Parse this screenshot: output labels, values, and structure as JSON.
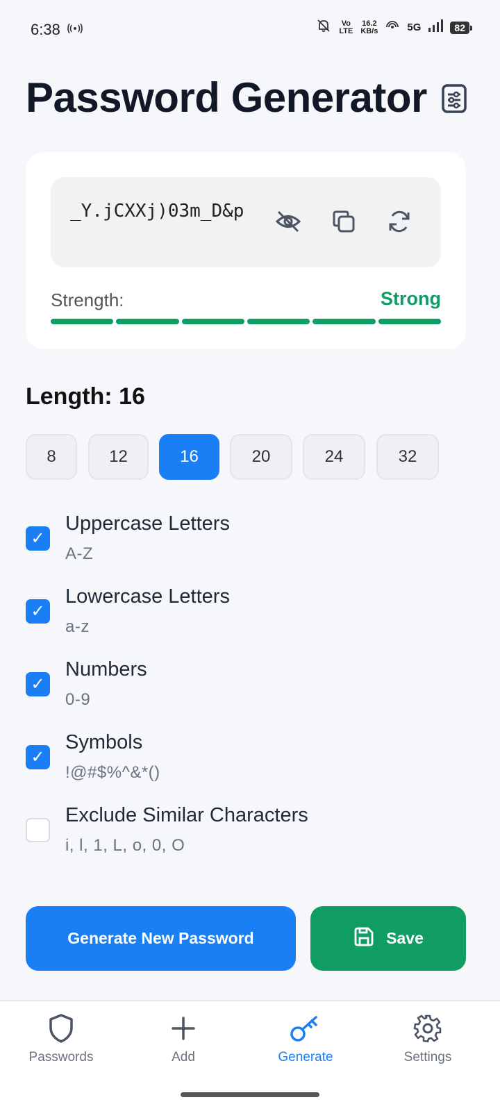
{
  "status_bar": {
    "time": "6:38",
    "volte": "Vo LTE",
    "speed_value": "16.2",
    "speed_unit": "KB/s",
    "network": "5G",
    "battery": "82"
  },
  "header": {
    "title": "Password Generator",
    "icon": "document-settings-icon"
  },
  "password_card": {
    "password": "_Y.jCXXj)03m_D&p",
    "icons": [
      "eye-off-icon",
      "copy-icon",
      "refresh-icon"
    ],
    "strength_label": "Strength:",
    "strength_value": "Strong",
    "strength_segments_filled": 6,
    "strength_segments_total": 6
  },
  "length": {
    "label": "Length:",
    "value": "16",
    "options": [
      "8",
      "12",
      "16",
      "20",
      "24",
      "32"
    ],
    "selected": "16"
  },
  "options": [
    {
      "title": "Uppercase Letters",
      "subtitle": "A-Z",
      "checked": true
    },
    {
      "title": "Lowercase Letters",
      "subtitle": "a-z",
      "checked": true
    },
    {
      "title": "Numbers",
      "subtitle": "0-9",
      "checked": true
    },
    {
      "title": "Symbols",
      "subtitle": "!@#$%^&*()",
      "checked": true
    },
    {
      "title": "Exclude Similar Characters",
      "subtitle": "i, l, 1, L, o, 0, O",
      "checked": false
    }
  ],
  "actions": {
    "generate_label": "Generate New Password",
    "save_label": "Save"
  },
  "bottom_nav": {
    "items": [
      {
        "label": "Passwords",
        "icon": "shield-icon"
      },
      {
        "label": "Add",
        "icon": "plus-icon"
      },
      {
        "label": "Generate",
        "icon": "key-icon",
        "active": true
      },
      {
        "label": "Settings",
        "icon": "gear-icon"
      }
    ]
  },
  "colors": {
    "primary": "#1a7ff5",
    "success": "#0f9d63",
    "background": "#f5f7fa"
  }
}
